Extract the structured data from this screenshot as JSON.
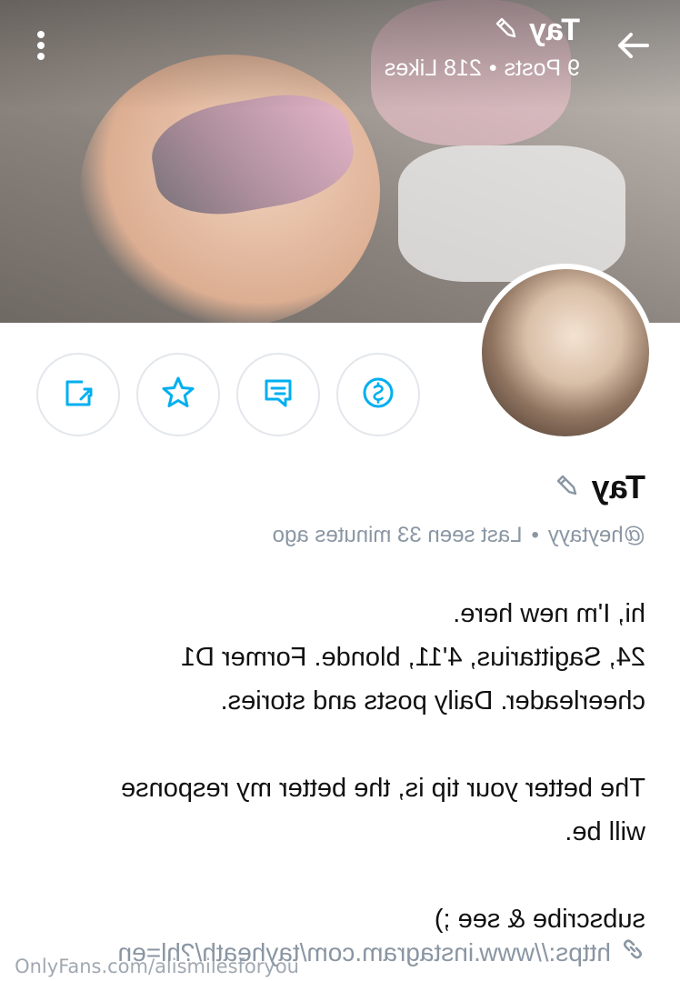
{
  "header": {
    "title": "Tay",
    "posts": "9 Posts",
    "separator": "•",
    "likes": "218 Likes"
  },
  "icons": {
    "back": "arrow-right-icon",
    "more": "more-vertical-icon",
    "edit": "pencil-icon",
    "share": "share-icon",
    "favorite": "star-icon",
    "message": "message-icon",
    "tip": "dollar-icon",
    "link": "link-icon"
  },
  "colors": {
    "accent": "#00aff0",
    "muted": "#8a96a3"
  },
  "profile": {
    "name": "Tay",
    "handle": "@heytayy",
    "separator": "•",
    "last_seen": "Last seen 33 minutes ago",
    "bio": [
      "hi, I'm new here.",
      "24, Sagittarius, 4'11, blonde. Former D1",
      "cheerleader. Daily posts and stories.",
      "",
      "The better your tip is, the better my response",
      "will be.",
      "",
      "subscribe & see ;)"
    ],
    "link": "https://www.instagram.com/tayheath/?hl=en"
  },
  "watermark": "OnlyFans.com/alismilesforyou"
}
